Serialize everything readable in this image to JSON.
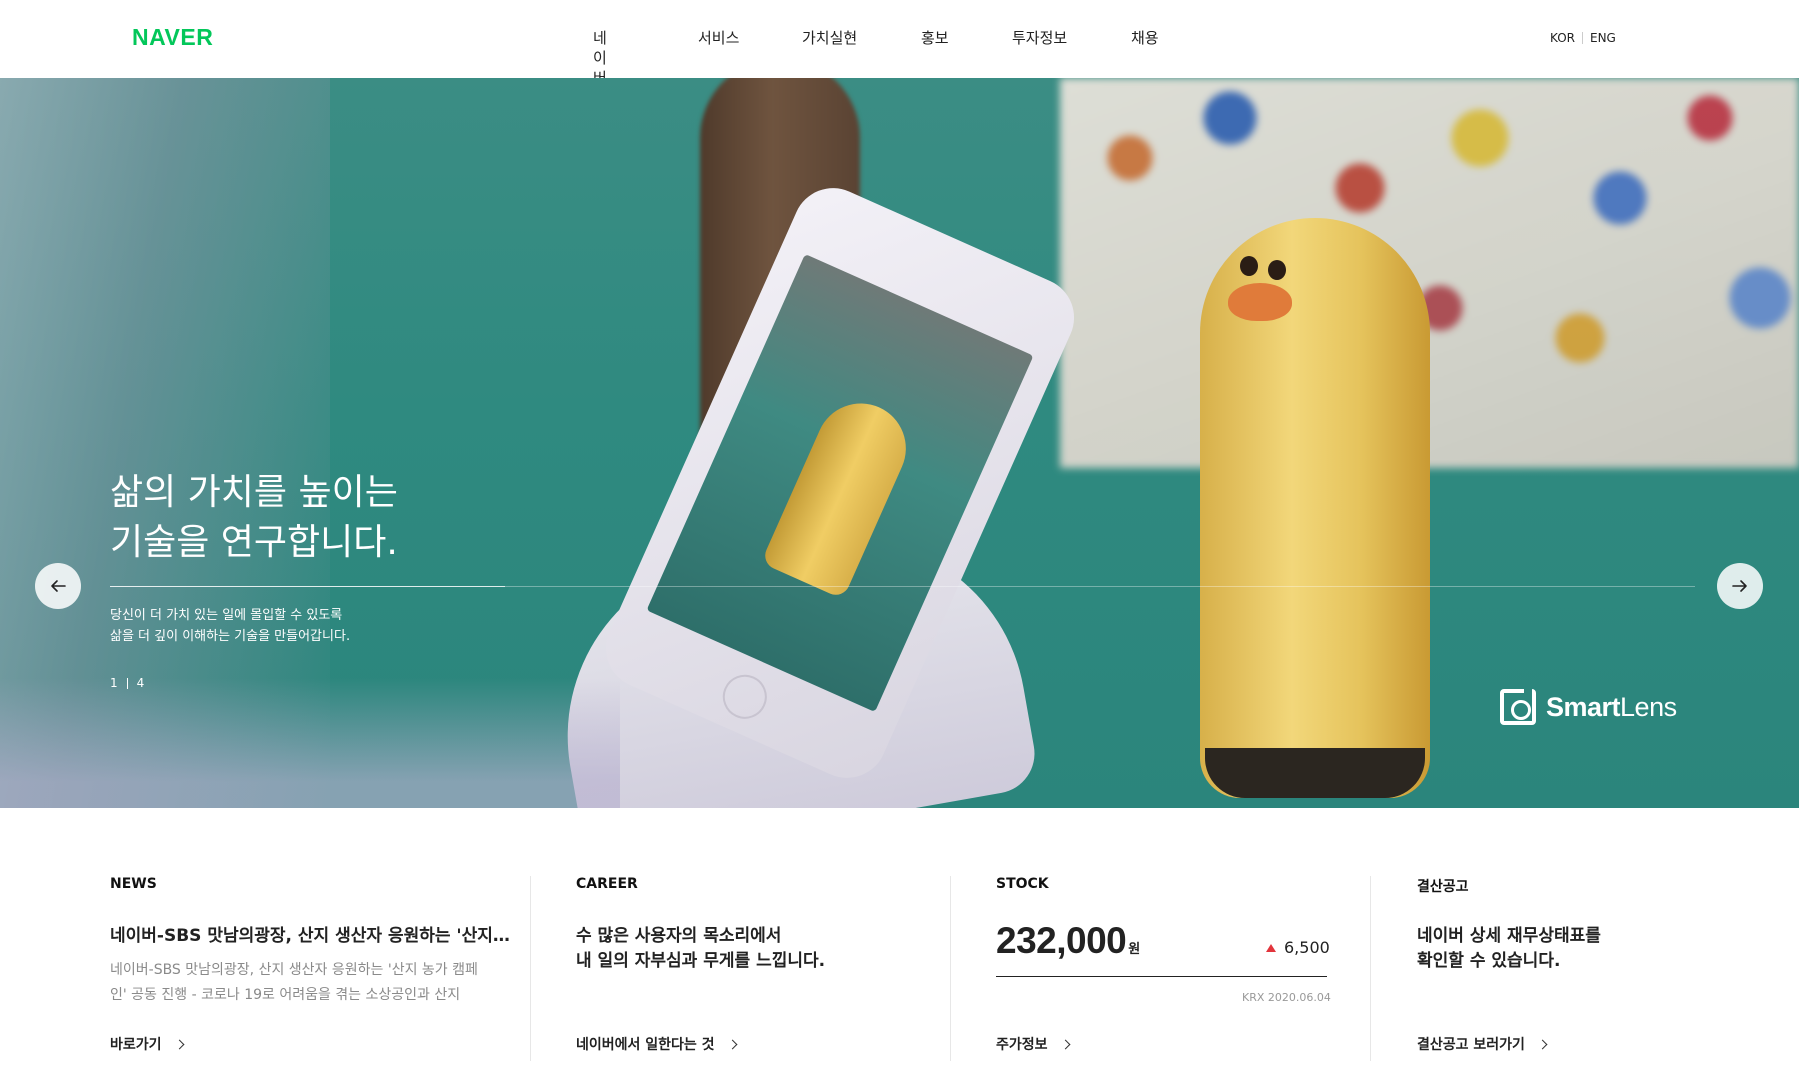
{
  "header": {
    "logo": "NAVER",
    "nav": [
      "네이버",
      "서비스",
      "가치실현",
      "홍보",
      "투자정보",
      "채용"
    ],
    "lang": [
      "KOR",
      "ENG"
    ]
  },
  "hero": {
    "title_line1": "삶의 가치를 높이는",
    "title_line2": "기술을 연구합니다.",
    "desc_line1": "당신이 더 가치 있는 일에 몰입할 수 있도록",
    "desc_line2": "삶을 더 깊이 이해하는 기술을 만들어갑니다.",
    "pager_current": "1",
    "pager_total": "4",
    "badge_smart": "Smart",
    "badge_lens": "Lens"
  },
  "cards": {
    "news": {
      "label": "NEWS",
      "headline": "네이버-SBS 맛남의광장, 산지 생산자 응원하는 '산지 농…",
      "text": "네이버-SBS 맛남의광장, 산지 생산자 응원하는 '산지 농가 캠페인' 공동 진행 - 코로나 19로 어려움을 겪는 소상공인과 산지",
      "link": "바로가기"
    },
    "career": {
      "label": "CAREER",
      "headline_line1": "수 많은 사용자의 목소리에서",
      "headline_line2": "내 일의 자부심과 무게를 느낍니다.",
      "link": "네이버에서 일한다는 것"
    },
    "stock": {
      "label": "STOCK",
      "price": "232,000",
      "unit": "원",
      "change": "6,500",
      "date": "KRX 2020.06.04",
      "link": "주가정보"
    },
    "report": {
      "label": "결산공고",
      "headline_line1": "네이버 상세 재무상태표를",
      "headline_line2": "확인할 수 있습니다.",
      "link": "결산공고 보러가기"
    }
  },
  "colors": {
    "brand": "#03c75a",
    "up": "#e2343c"
  }
}
